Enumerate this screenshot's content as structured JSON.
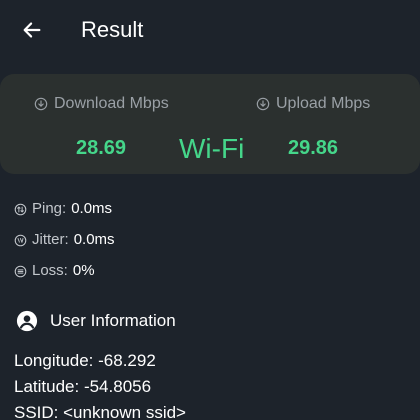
{
  "header": {
    "title": "Result",
    "back_icon": "arrow-left-icon"
  },
  "result": {
    "download_label": "Download Mbps",
    "upload_label": "Upload Mbps",
    "download_value": "28.69",
    "upload_value": "29.86",
    "connection_type": "Wi-Fi",
    "accent_color": "#45d68a"
  },
  "stats": {
    "ping_label": "Ping:",
    "ping_value": "0.0ms",
    "jitter_label": "Jitter:",
    "jitter_value": "0.0ms",
    "loss_label": "Loss:",
    "loss_value": "0%"
  },
  "user_info": {
    "heading": "User Information",
    "longitude": "Longitude: -68.292",
    "latitude": "Latitude: -54.8056",
    "ssid": "SSID: <unknown ssid>"
  }
}
